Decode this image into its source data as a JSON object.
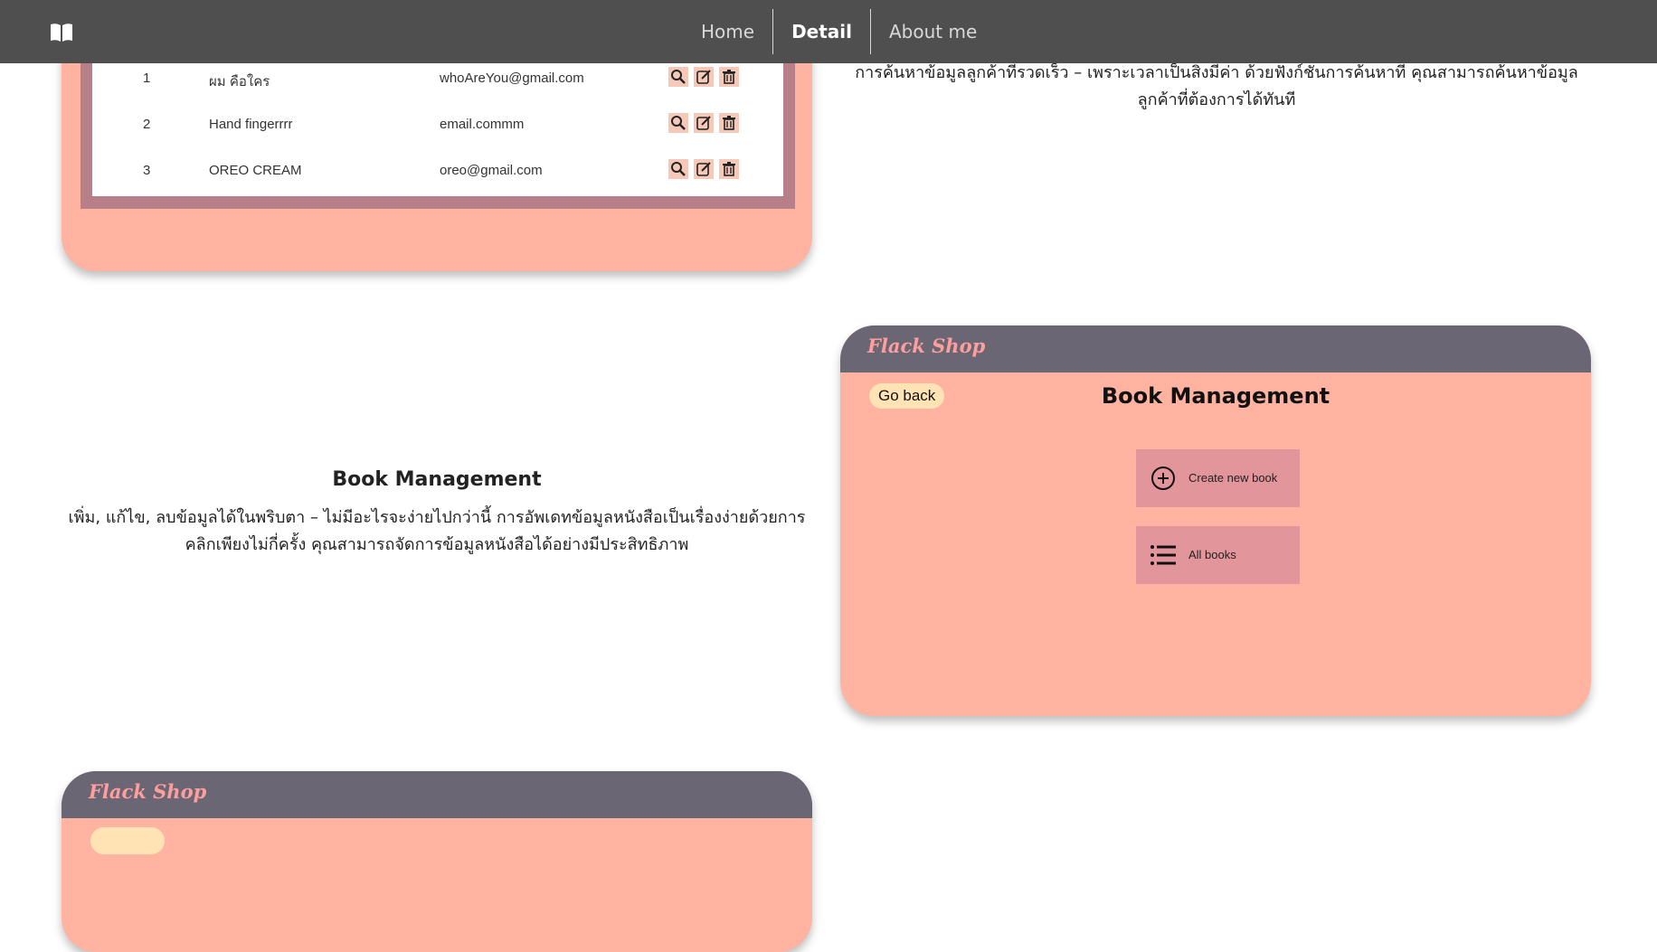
{
  "nav": {
    "links": [
      {
        "label": "Home"
      },
      {
        "label": "Detail"
      },
      {
        "label": "About me"
      }
    ]
  },
  "customer_table": {
    "rows": [
      {
        "id": "1",
        "name": "ผม คือใคร",
        "email": "whoAreYou@gmail.com"
      },
      {
        "id": "2",
        "name": "Hand fingerrrr",
        "email": "email.commm"
      },
      {
        "id": "3",
        "name": "OREO CREAM",
        "email": "oreo@gmail.com"
      }
    ]
  },
  "customer_search_text": "การค้นหาข้อมูลลูกค้าที่รวดเร็ว – เพราะเวลาเป็นสิ่งมีค่า ด้วยฟังก์ชันการค้นหาที่ คุณสามารถค้นหาข้อมูลลูกค้าที่ต้องการได้ทันที",
  "book_feature": {
    "title": "Book Management",
    "description": "เพิ่ม, แก้ไข, ลบข้อมูลได้ในพริบตา – ไม่มีอะไรจะง่ายไปกว่านี้ การอัพเดทข้อมูลหนังสือเป็นเรื่องง่ายด้วยการคลิกเพียงไม่กี่ครั้ง คุณสามารถจัดการข้อมูลหนังสือได้อย่างมีประสิทธิภาพ"
  },
  "book_card": {
    "brand": "Flack Shop",
    "go_back": "Go back",
    "title": "Book Management",
    "buttons": [
      {
        "label": "Create new book",
        "icon": "plus-circle-icon"
      },
      {
        "label": "All books",
        "icon": "list-icon"
      }
    ]
  },
  "bottom_card": {
    "brand": "Flack Shop"
  },
  "colors": {
    "nav_bg": "#4f4f4f",
    "card_bg": "#ffb3a0",
    "card_header": "#6b6673",
    "brand_text": "#ff9e9e",
    "menu_button": "#e2959a",
    "pill": "#ffe3b5"
  }
}
